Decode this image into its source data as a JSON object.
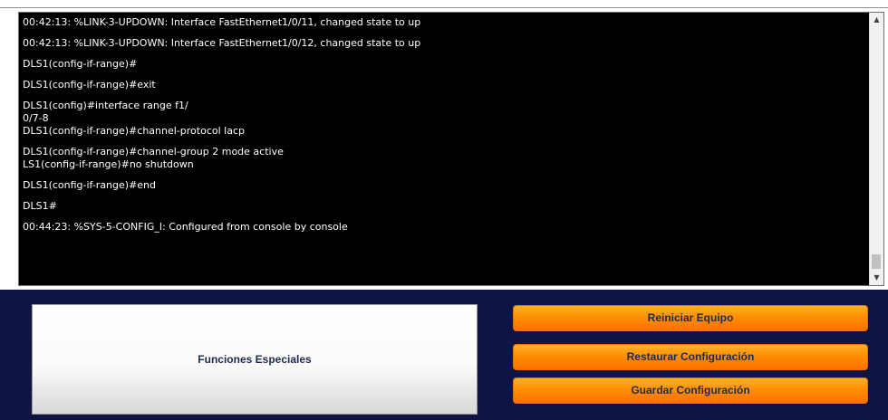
{
  "console": {
    "lines": [
      "00:42:13: %LINK-3-UPDOWN: Interface FastEthernet1/0/11, changed state to up",
      "",
      "00:42:13: %LINK-3-UPDOWN: Interface FastEthernet1/0/12, changed state to up",
      "",
      "DLS1(config-if-range)#",
      "",
      "DLS1(config-if-range)#exit",
      "",
      "DLS1(config)#interface range f1/",
      "0/7-8",
      "DLS1(config-if-range)#channel-protocol lacp",
      "",
      "DLS1(config-if-range)#channel-group 2 mode active",
      "LS1(config-if-range)#no shutdown",
      "",
      "DLS1(config-if-range)#end",
      "",
      "DLS1#",
      "",
      "00:44:23: %SYS-5-CONFIG_I: Configured from console by console"
    ]
  },
  "panel": {
    "special_label": "Funciones Especiales",
    "buttons": {
      "reiniciar": "Reiniciar Equipo",
      "restaurar": "Restaurar Configuración",
      "guardar": "Guardar Configuración"
    }
  },
  "colors": {
    "console_bg": "#000000",
    "console_text": "#ffffff",
    "panel_bg": "#0f1445",
    "button_orange": "#ff8d00"
  }
}
